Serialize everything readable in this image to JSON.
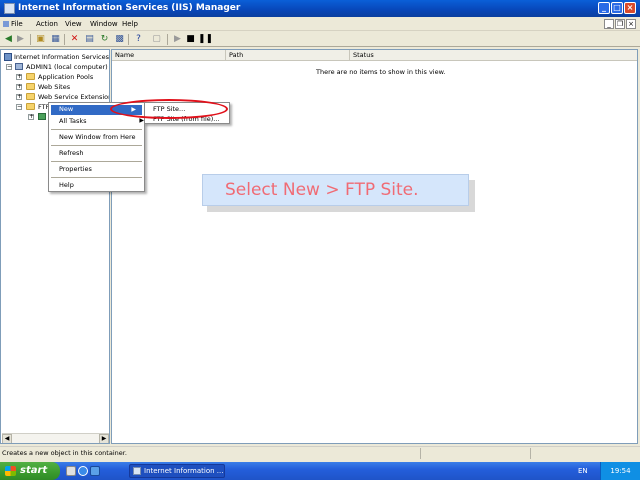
{
  "window": {
    "title": "Internet Information Services (IIS) Manager",
    "controls": {
      "minimize": "_",
      "maximize": "□",
      "close": "×"
    }
  },
  "menubar": {
    "items": [
      "File",
      "Action",
      "View",
      "Window",
      "Help"
    ],
    "mdi_controls": {
      "minimize": "_",
      "restore": "❐",
      "close": "×"
    }
  },
  "tree": {
    "items": [
      {
        "label": "Internet Information Services",
        "icon": "iis-root-icon"
      },
      {
        "label": "ADMIN1 (local computer)",
        "icon": "computer-icon"
      },
      {
        "label": "Application Pools",
        "icon": "folder-icon"
      },
      {
        "label": "Web Sites",
        "icon": "folder-icon"
      },
      {
        "label": "Web Service Extension",
        "icon": "folder-icon"
      },
      {
        "label": "FTP Sites",
        "icon": "folder-icon"
      }
    ]
  },
  "list": {
    "columns": [
      "Name",
      "Path",
      "Status"
    ],
    "empty_message": "There are no items to show in this view."
  },
  "context_menu": {
    "items": [
      "New",
      "All Tasks",
      "New Window from Here",
      "Refresh",
      "Properties",
      "Help"
    ]
  },
  "submenu": {
    "items": [
      "FTP Site...",
      "FTP Site (from file)..."
    ]
  },
  "callout": {
    "text": "Select New > FTP Site."
  },
  "statusbar": {
    "text": "Creates a new object in this container."
  },
  "taskbar": {
    "start_label": "start",
    "task_label": "Internet Information ...",
    "language": "EN",
    "clock": "19:54"
  },
  "colors": {
    "accent": "#316ac5",
    "callout_text": "#f06b74",
    "highlight_ring": "#e0101a"
  }
}
